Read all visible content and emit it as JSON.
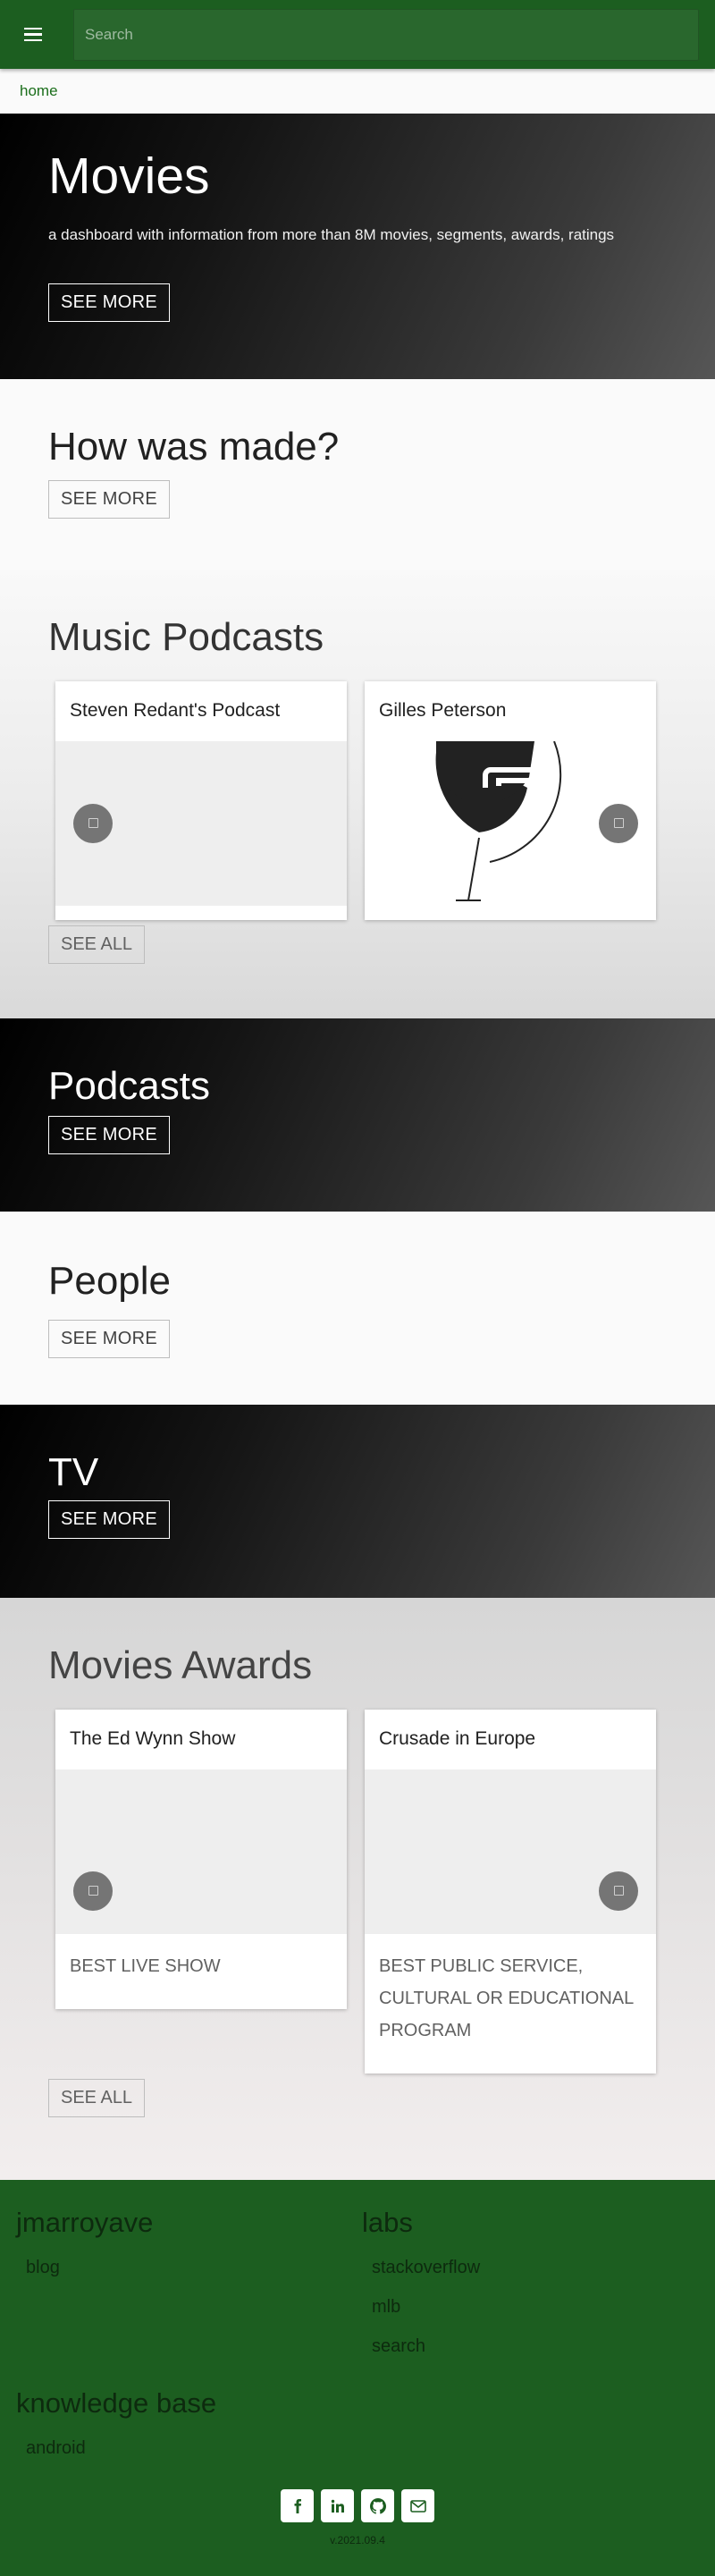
{
  "header": {
    "search_placeholder": "Search"
  },
  "breadcrumb": {
    "home": "home"
  },
  "hero": {
    "title": "Movies",
    "subtitle": "a dashboard with information from more than 8M movies, segments, awards, ratings",
    "button": "SEE MORE"
  },
  "how_made": {
    "title": "How was made?",
    "button": "SEE MORE"
  },
  "music_podcasts": {
    "title": "Music Podcasts",
    "cards": [
      {
        "title": "Steven Redant's Podcast"
      },
      {
        "title": "Gilles Peterson"
      }
    ],
    "button": "SEE ALL"
  },
  "podcasts": {
    "title": "Podcasts",
    "button": "SEE MORE"
  },
  "people": {
    "title": "People",
    "button": "SEE MORE"
  },
  "tv": {
    "title": "TV",
    "button": "SEE MORE"
  },
  "awards": {
    "title": "Movies Awards",
    "cards": [
      {
        "title": "The Ed Wynn Show",
        "award": "BEST LIVE SHOW"
      },
      {
        "title": "Crusade in Europe",
        "award": "BEST PUBLIC SERVICE, CULTURAL OR EDUCATIONAL PROGRAM"
      }
    ],
    "button": "SEE ALL"
  },
  "footer": {
    "col1": {
      "title": "jmarroyave",
      "links": [
        "blog"
      ]
    },
    "col2": {
      "title": "labs",
      "links": [
        "stackoverflow",
        "mlb",
        "search"
      ]
    },
    "col3": {
      "title": "knowledge base",
      "links": [
        "android"
      ]
    },
    "social_icons": [
      "facebook-icon",
      "linkedin-icon",
      "github-icon",
      "mail-icon"
    ],
    "version": "v.2021.09.4"
  },
  "colors": {
    "brand_green": "#1c5e20",
    "link_green": "#1b6e1b"
  }
}
